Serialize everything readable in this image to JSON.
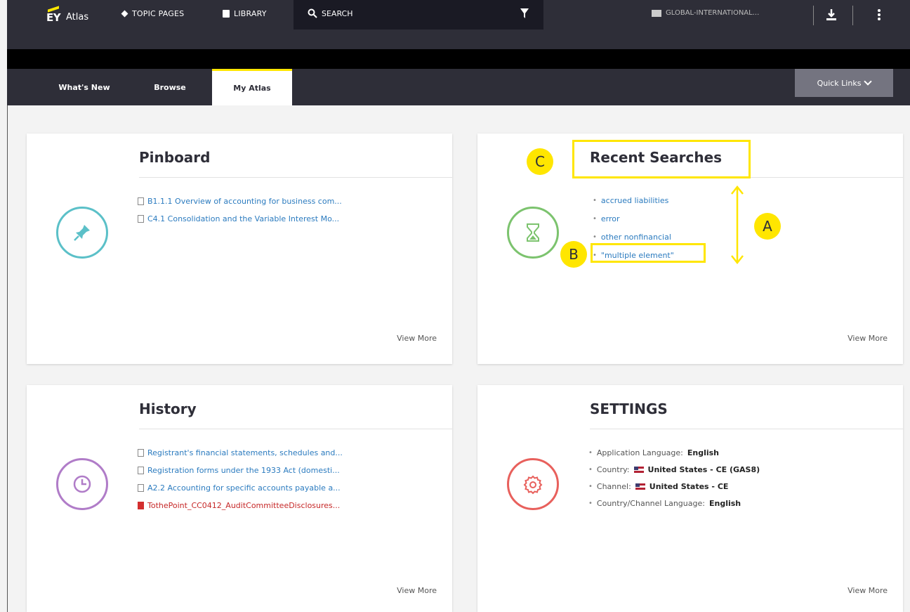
{
  "header": {
    "logo_ey": "EY",
    "logo_atlas": "Atlas",
    "nav_topic_pages": "TOPIC PAGES",
    "nav_library": "LIBRARY",
    "search_label": "SEARCH",
    "region": "GLOBAL-INTERNATIONAL..."
  },
  "tabs": {
    "whats_new": "What's New",
    "browse": "Browse",
    "my_atlas": "My Atlas",
    "quick_links": "Quick Links"
  },
  "pinboard": {
    "title": "Pinboard",
    "items": [
      "B1.1.1 Overview of accounting for business com...",
      "C4.1 Consolidation and the Variable Interest Mo..."
    ],
    "view_more": "View More"
  },
  "recent_searches": {
    "title": "Recent Searches",
    "items": [
      "accrued liabilities",
      "error",
      "other nonfinancial",
      "\"multiple element\""
    ],
    "view_more": "View More"
  },
  "history": {
    "title": "History",
    "items": [
      "Registrant's financial statements, schedules and...",
      "Registration forms under the 1933 Act (domesti...",
      "A2.2 Accounting for specific accounts payable a...",
      "TothePoint_CC0412_AuditCommitteeDisclosures..."
    ],
    "view_more": "View More"
  },
  "settings": {
    "title": "SETTINGS",
    "app_language_label": "Application Language:",
    "app_language_value": "English",
    "country_label": "Country:",
    "country_value": "United States - CE (GAS8)",
    "channel_label": "Channel:",
    "channel_value": "United States - CE",
    "channel_language_label": "Country/Channel Language:",
    "channel_language_value": "English",
    "view_more": "View More"
  },
  "annotations": {
    "a": "A",
    "b": "B",
    "c": "C"
  },
  "colors": {
    "topbar": "#2e2e38",
    "accent": "#ffe600",
    "link": "#2b7bbf",
    "pin_icon": "#5bc0c8",
    "recent_icon": "#7cc36e",
    "history_icon": "#b07cc8",
    "settings_icon": "#e8605c"
  },
  "icons": {
    "pinboard": "pin-icon",
    "recent": "hourglass-icon",
    "history": "clock-icon",
    "settings": "gear-icon"
  }
}
